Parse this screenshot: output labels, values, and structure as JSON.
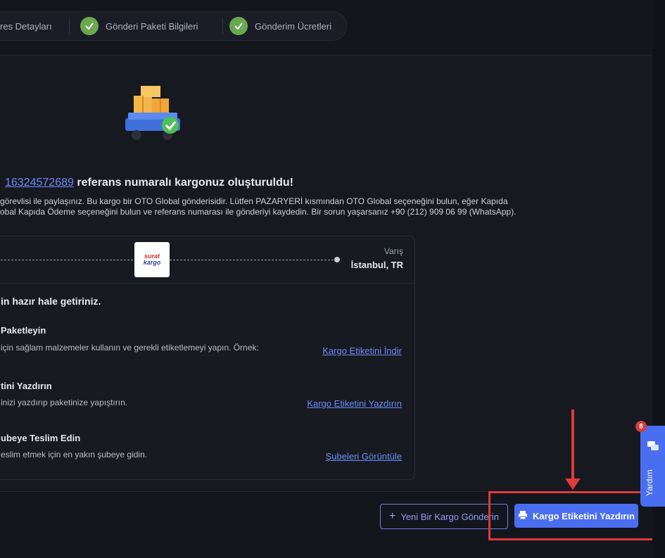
{
  "steps": [
    {
      "label": "res Detayları"
    },
    {
      "label": "Gönderi Paketi Bilgileri"
    },
    {
      "label": "Gönderim Ücretleri"
    }
  ],
  "success": {
    "reference": "16324572689",
    "headline_rest": " referans numaralı kargonuz oluşturuldu!",
    "paragraph_line1": "görevlisi ile paylaşınız. Bu kargo bir OTO Global gönderisidir. Lütfen PAZARYERİ kısmından OTO Global seçeneğini bulun, eğer Kapıda",
    "paragraph_line2": "obal Kapıda Ödeme seçeneğini bulun ve referans numarası ile gönderiyi kaydedin. Bir sorun yaşarsanız +90 (212) 909 06 99 (WhatsApp)."
  },
  "route": {
    "carrier_logo_line1": "surat",
    "carrier_logo_line2": "kargo",
    "destination_label": "Varış",
    "destination_city": "İstanbul, TR"
  },
  "instructions": {
    "title": "in hazır hale getiriniz.",
    "steps": [
      {
        "title": "Paketleyin",
        "desc": "için sağlam malzemeler kullanın ve gerekli etiketlemeyi yapın. Örnek:",
        "link": "Kargo Etiketini İndir"
      },
      {
        "title": "tini Yazdırın",
        "desc": "inizi yazdırıp paketinize yapıştırın.",
        "link": "Kargo Etiketini Yazdırın"
      },
      {
        "title": "ubeye Teslim Edin",
        "desc": "eslim etmek için en yakın şubeye gidin.",
        "link": "Şubeleri Görüntüle"
      }
    ]
  },
  "actions": {
    "new_shipment": "Yeni Bir Kargo Gönderin",
    "print_label": "Kargo Etiketini Yazdırın"
  },
  "help": {
    "label": "Yardım",
    "badge": "8"
  },
  "colors": {
    "accent": "#4a6ef0",
    "link": "#6d8cf7",
    "success": "#6aa84f",
    "annotation": "#e03a3a"
  }
}
